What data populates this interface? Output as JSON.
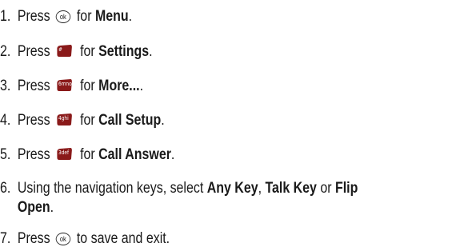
{
  "steps": [
    {
      "num": "1.",
      "pre": "Press",
      "key": "ok",
      "mid": "for",
      "bold": "Menu",
      "post": "."
    },
    {
      "num": "2.",
      "pre": "Press",
      "key": "#",
      "mid": "for",
      "bold": "Settings",
      "post": "."
    },
    {
      "num": "3.",
      "pre": "Press",
      "key": "6mno",
      "mid": "for",
      "bold": "More...",
      "post": "."
    },
    {
      "num": "4.",
      "pre": "Press",
      "key": "4ghi",
      "mid": "for",
      "bold": "Call Setup",
      "post": "."
    },
    {
      "num": "5.",
      "pre": "Press",
      "key": "3def",
      "mid": "for",
      "bold": "Call Answer",
      "post": "."
    },
    {
      "num": "6.",
      "text": "Using the navigation keys, select",
      "bold1": "Any Key",
      "sep1": ",",
      "bold2": "Talk Key",
      "sep2": "or",
      "bold3": "Flip",
      "bold4": "Open",
      "post": "."
    },
    {
      "num": "7.",
      "pre": "Press",
      "key": "ok",
      "post": "to save and exit."
    }
  ],
  "icons": {
    "ok": "ok-key-icon",
    "pound": "pound-key-icon",
    "six": "six-key-icon",
    "four": "four-key-icon",
    "three": "three-key-icon"
  },
  "colors": {
    "text": "#1a1a1a",
    "key_fill": "#8a1a1a"
  }
}
